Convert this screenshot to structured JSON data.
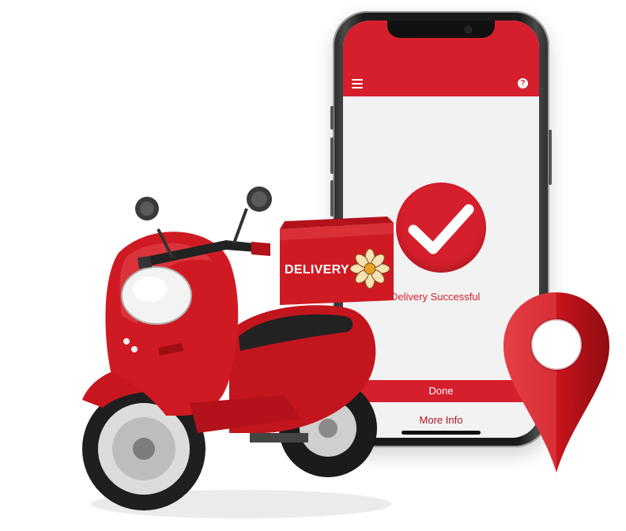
{
  "app": {
    "status_message": "Delivery Successful",
    "primary_action": "Done",
    "secondary_action": "More Info",
    "menu_icon": "hamburger-menu-icon",
    "help_icon": "question-mark-icon",
    "help_glyph": "?"
  },
  "illustration": {
    "box_label": "DELIVERY",
    "pin_icon": "location-pin-icon",
    "check_icon": "checkmark-icon"
  },
  "colors": {
    "brand_red": "#d61f2c",
    "screen_bg": "#f2f2f2",
    "phone_frame": "#1a1a1a"
  }
}
